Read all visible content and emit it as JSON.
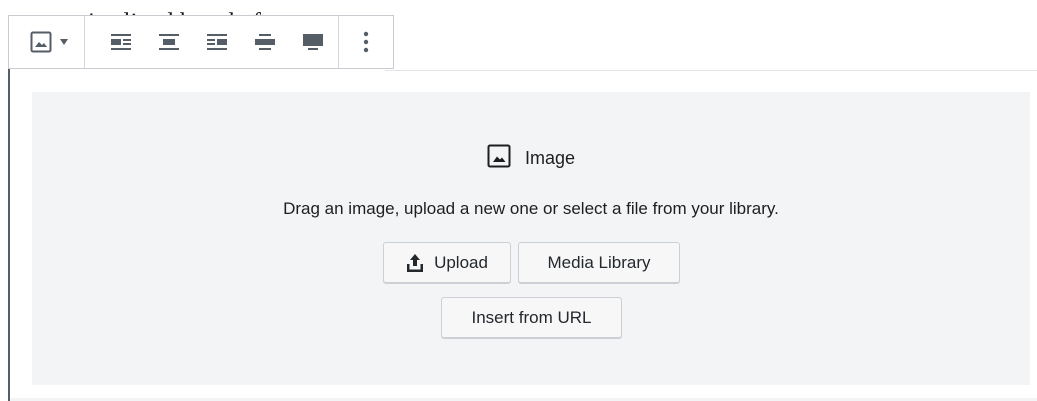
{
  "paragraph": {
    "text": "we've lived here before."
  },
  "toolbar": {
    "block_type_icon": "image-icon",
    "caret_icon": "caret-down-icon",
    "align_icons": [
      "align-left-icon",
      "align-center-icon",
      "align-right-icon",
      "align-wide-icon",
      "align-full-icon"
    ],
    "more_icon": "more-vertical-icon"
  },
  "placeholder": {
    "title_icon": "image-icon",
    "title": "Image",
    "instructions": "Drag an image, upload a new one or select a file from your library.",
    "upload_label": "Upload",
    "upload_icon": "upload-icon",
    "media_library_label": "Media Library",
    "insert_url_label": "Insert from URL"
  },
  "colors": {
    "icon": "#555d66",
    "placeholder_bg": "#f3f4f5",
    "button_bg": "#f7f7f7",
    "border": "#ccd0d4"
  }
}
